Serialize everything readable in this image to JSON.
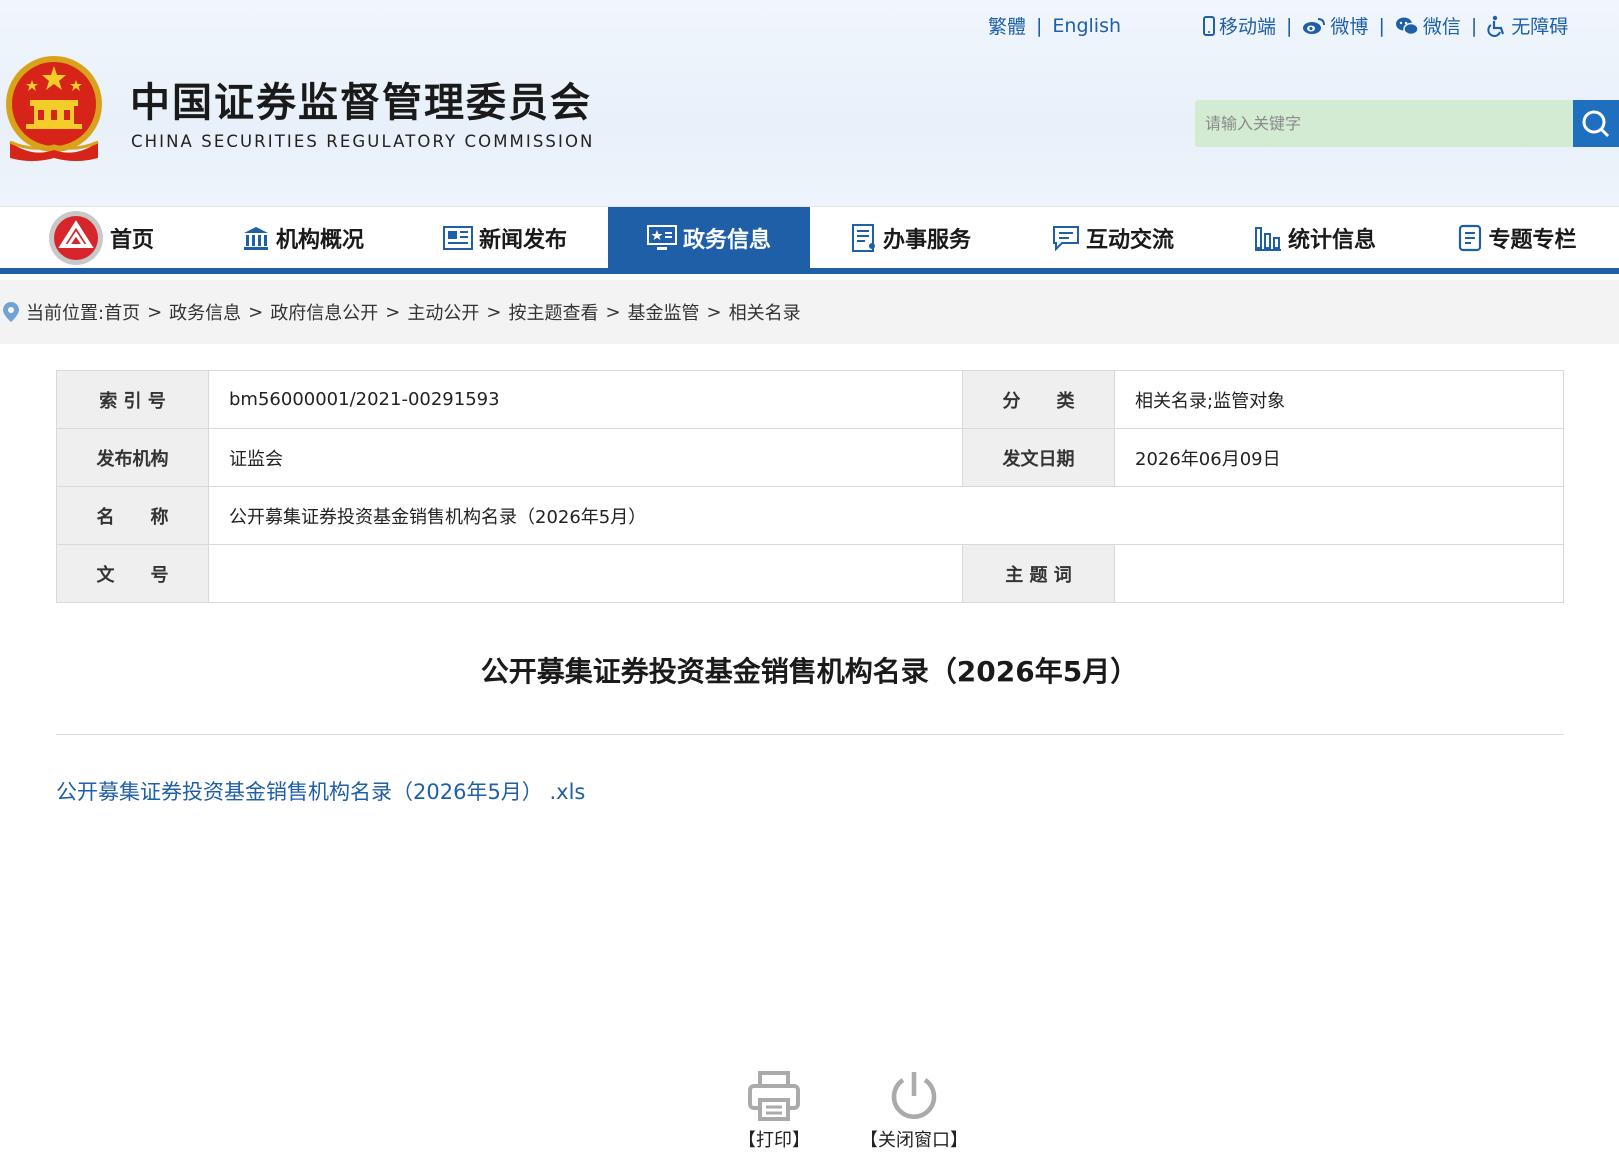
{
  "header": {
    "title_cn": "中国证券监督管理委员会",
    "title_en": "CHINA SECURITIES REGULATORY COMMISSION",
    "lang_traditional": "繁體",
    "lang_english": "English",
    "top_links": {
      "mobile": "移动端",
      "weibo": "微博",
      "wechat": "微信",
      "accessibility": "无障碍"
    },
    "search_placeholder": "请输入关键字"
  },
  "nav": {
    "items": [
      {
        "label": "首页",
        "icon": "csrc-logo-icon"
      },
      {
        "label": "机构概况",
        "icon": "building-icon"
      },
      {
        "label": "新闻发布",
        "icon": "news-icon"
      },
      {
        "label": "政务信息",
        "icon": "monitor-star-icon",
        "active": true
      },
      {
        "label": "办事服务",
        "icon": "form-icon"
      },
      {
        "label": "互动交流",
        "icon": "chat-icon"
      },
      {
        "label": "统计信息",
        "icon": "bar-chart-icon"
      },
      {
        "label": "专题专栏",
        "icon": "document-icon"
      }
    ]
  },
  "breadcrumb": {
    "prefix": "当前位置:",
    "items": [
      "首页",
      "政务信息",
      "政府信息公开",
      "主动公开",
      "按主题查看",
      "基金监管",
      "相关名录"
    ]
  },
  "meta": {
    "index_label": "索 引 号",
    "index_value": "bm56000001/2021-00291593",
    "category_label": "分　　类",
    "category_value": "相关名录;监管对象",
    "publisher_label": "发布机构",
    "publisher_value": "证监会",
    "date_label": "发文日期",
    "date_value": "2026年06月09日",
    "name_label": "名　　称",
    "name_value": "公开募集证券投资基金销售机构名录（2026年5月）",
    "docno_label": "文　　号",
    "docno_value": "",
    "keywords_label": "主 题 词",
    "keywords_value": ""
  },
  "article": {
    "title": "公开募集证券投资基金销售机构名录（2026年5月）",
    "attachment": "公开募集证券投资基金销售机构名录（2026年5月） .xls"
  },
  "actions": {
    "print": "【打印】",
    "close": "【关闭窗口】"
  },
  "colors": {
    "brand_blue": "#1f5fa8",
    "search_bg": "#d2ebd2",
    "label_bg": "#efefef"
  }
}
